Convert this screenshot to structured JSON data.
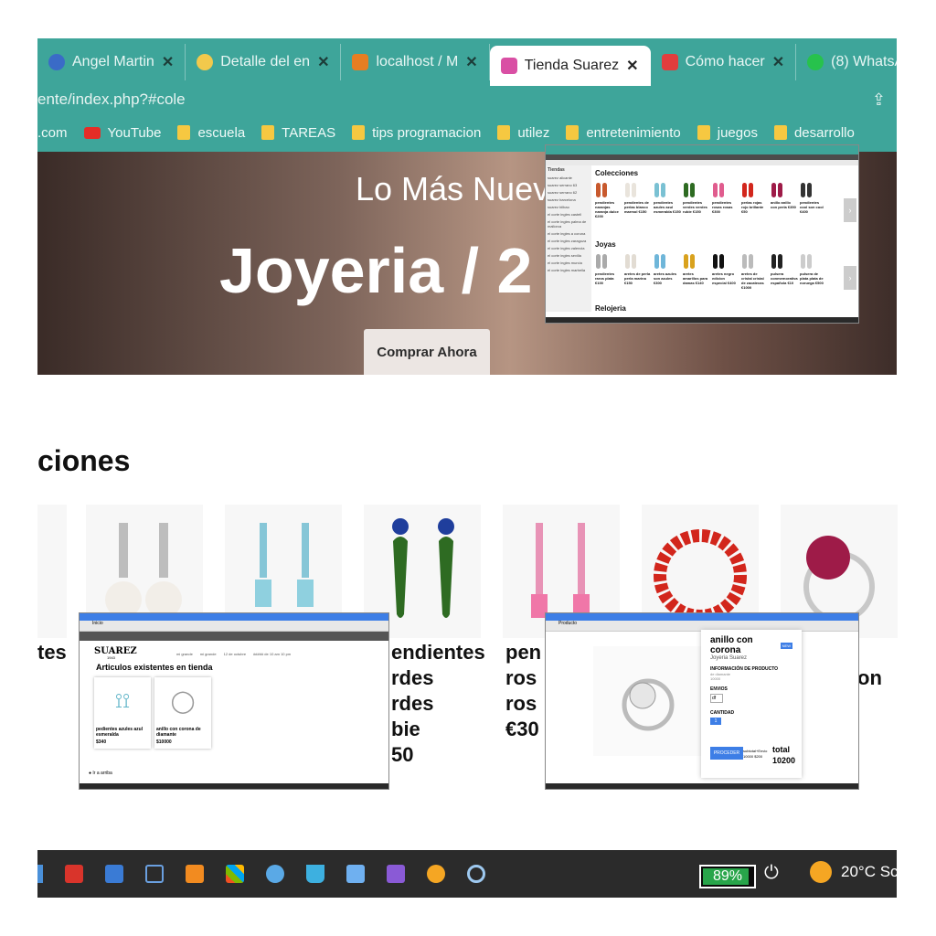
{
  "browser": {
    "tabs": [
      {
        "label": "Angel Martin",
        "icon": "gear-icon",
        "color": "#3a6bc7"
      },
      {
        "label": "Detalle del en",
        "icon": "eye-icon",
        "color": "#f2c94c"
      },
      {
        "label": "localhost / M",
        "icon": "phpmyadmin-icon",
        "color": "#e67e22"
      },
      {
        "label": "Tienda Suarez",
        "icon": "store-icon",
        "color": "#d94fa4",
        "active": true
      },
      {
        "label": "Cómo hacer",
        "icon": "linkedin-icon",
        "color": "#e23d3d"
      },
      {
        "label": "(8) WhatsApp",
        "icon": "whatsapp-icon",
        "color": "#27c24c"
      }
    ],
    "address": "ente/index.php?#cole",
    "bookmarks": [
      {
        "label": ".com",
        "icon": "none"
      },
      {
        "label": "YouTube",
        "icon": "youtube-icon"
      },
      {
        "label": "escuela",
        "icon": "folder-icon"
      },
      {
        "label": "TAREAS",
        "icon": "folder-icon"
      },
      {
        "label": "tips programacion",
        "icon": "folder-icon"
      },
      {
        "label": "utilez",
        "icon": "folder-icon"
      },
      {
        "label": "entretenimiento",
        "icon": "folder-icon"
      },
      {
        "label": "juegos",
        "icon": "folder-icon"
      },
      {
        "label": "desarrollo",
        "icon": "folder-icon"
      }
    ]
  },
  "hero": {
    "subtitle": "Lo Más Nuev",
    "title": "Joyeria / 2",
    "button": "Comprar Ahora"
  },
  "mini_store": {
    "sidebar_title": "Tiendas",
    "sidebar_items": [
      "suarez alicante",
      "suarez serrano 63",
      "suarez serrano 62",
      "suarez barcelona",
      "suarez bilbao",
      "el corte ingles castell",
      "el corte ingles palma de mallorca",
      "el corte ingles a coruna",
      "el corte ingles zaragoza",
      "el corte ingles valencia",
      "el corte ingles sevilla",
      "el corte ingles murcia",
      "el corte ingles marbella"
    ],
    "section1": "Colecciones",
    "section2": "Joyas",
    "section3": "Relojeria",
    "row1": [
      "pendientes naranjas naranja dulce €200",
      "pendientes de perlas blanco marmol €150",
      "pendientes azules azul esmeralda €150",
      "pendientes verdes verdes rubie €150",
      "pendientes rosas rosas €300",
      "perlas rojas rojo brillante €50",
      "anillo anillo con perla €350",
      "pendientes cool son cool €400"
    ],
    "row2": [
      "pendientes raros plata €100",
      "aretes de perla perla marina €150",
      "aretes azules son azules €300",
      "aretes amarillos para damas €140",
      "aretes negro edicion especial €400",
      "aretes de cristal cristal de zacatecas €1000",
      "pulsera conmemorativa española €10",
      "pulsera de plata plata de noruega €500"
    ]
  },
  "collections": {
    "title": "ciones",
    "cards_text": {
      "left": "tes",
      "green": [
        "endientes",
        "rdes",
        "rdes",
        "bie",
        "50"
      ],
      "pink": [
        "pen",
        "ros",
        "ros",
        "€30"
      ],
      "right": "on"
    }
  },
  "mini_cart": {
    "tab": "Inicio",
    "brand": "SUAREZ",
    "brand_year": "1943",
    "nav": [
      "mi grande",
      "mi grande",
      "12 de octubre",
      "##### de 10 am 10 pm"
    ],
    "heading": "Articulos existentes en tienda",
    "items": [
      {
        "name": "pedientes azules azul esmeralda",
        "price": "$340"
      },
      {
        "name": "anillo con corona de diamante",
        "price": "$10000"
      }
    ],
    "back": "Ir a arriba"
  },
  "mini_product": {
    "tab": "Producto",
    "name": "anillo con corona",
    "badge": "NEW",
    "brand": "Joyeria Suarez",
    "info_title": "INFORMACIÓN DE PRODUCTO",
    "info_text": "de diamante",
    "info_price": "10000",
    "shipping_title": "ENVIOS",
    "shipping_value": "df",
    "qty_title": "CANTIDAD",
    "qty_value": "1",
    "button": "PROCEDER",
    "subtotal_label": "subtotal+Envio",
    "subtotal_values": "10000 $200",
    "total_label": "total",
    "total_value": "10200"
  },
  "taskbar": {
    "battery": "89%",
    "battery_level": 0.89,
    "weather": "20°C Sc"
  }
}
